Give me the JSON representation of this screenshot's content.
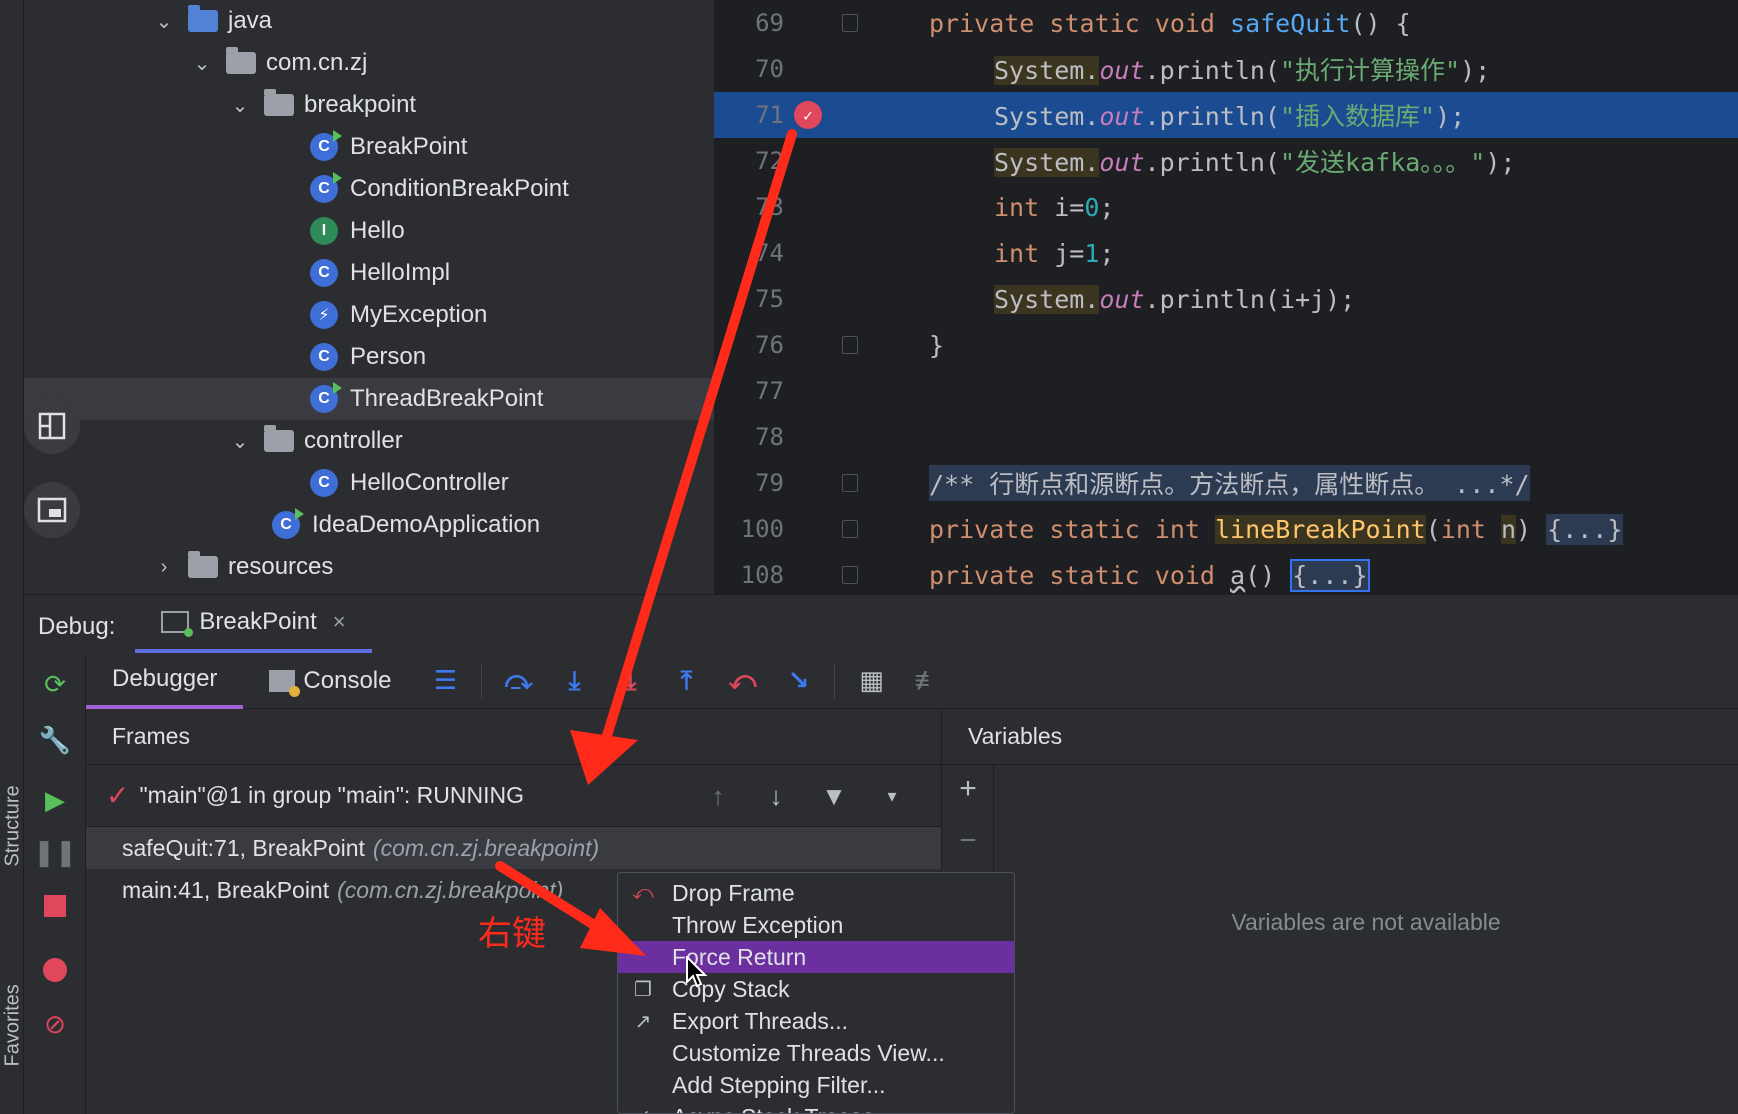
{
  "sidebar": {
    "structure_label": "Structure",
    "favorites_label": "Favorites"
  },
  "project_tree": {
    "items": [
      {
        "label": "java",
        "kind": "folder-blue",
        "chevron": "down",
        "indent": 0
      },
      {
        "label": "com.cn.zj",
        "kind": "package",
        "chevron": "down",
        "indent": 1
      },
      {
        "label": "breakpoint",
        "kind": "package",
        "chevron": "down",
        "indent": 2
      },
      {
        "label": "BreakPoint",
        "kind": "class-run",
        "indent": 3
      },
      {
        "label": "ConditionBreakPoint",
        "kind": "class-run",
        "indent": 3
      },
      {
        "label": "Hello",
        "kind": "interface",
        "indent": 3
      },
      {
        "label": "HelloImpl",
        "kind": "class",
        "indent": 3
      },
      {
        "label": "MyException",
        "kind": "exception",
        "indent": 3
      },
      {
        "label": "Person",
        "kind": "class",
        "indent": 3
      },
      {
        "label": "ThreadBreakPoint",
        "kind": "class-run",
        "indent": 3,
        "selected": true
      },
      {
        "label": "controller",
        "kind": "package",
        "chevron": "down",
        "indent": 2
      },
      {
        "label": "HelloController",
        "kind": "class",
        "indent": 3
      },
      {
        "label": "IdeaDemoApplication",
        "kind": "spring-class",
        "indent": 2
      },
      {
        "label": "resources",
        "kind": "resources-folder",
        "chevron": "right",
        "indent": 0
      }
    ]
  },
  "editor": {
    "lines": [
      {
        "num": "69",
        "text": "private static void safeQuit() {"
      },
      {
        "num": "70",
        "text": "System.out.println(\"执行计算操作\");"
      },
      {
        "num": "71",
        "text": "System.out.println(\"插入数据库\");",
        "current": true
      },
      {
        "num": "72",
        "text": "System.out.println(\"发送kafka。。。\");"
      },
      {
        "num": "73",
        "text": "int i=0;"
      },
      {
        "num": "74",
        "text": "int j=1;"
      },
      {
        "num": "75",
        "text": "System.out.println(i+j);"
      },
      {
        "num": "76",
        "text": "}"
      },
      {
        "num": "77",
        "text": ""
      },
      {
        "num": "78",
        "text": ""
      },
      {
        "num": "79",
        "text": "/** 行断点和源断点。方法断点，属性断点。 ...*/"
      },
      {
        "num": "100",
        "text": "private static int lineBreakPoint(int n) {...}"
      },
      {
        "num": "108",
        "text": "private static void a() {...}"
      }
    ]
  },
  "debug": {
    "label": "Debug:",
    "session_tab": "BreakPoint",
    "close_glyph": "×",
    "tabs": {
      "debugger": "Debugger",
      "console": "Console"
    },
    "frames_title": "Frames",
    "variables_title": "Variables",
    "thread": "\"main\"@1 in group \"main\": RUNNING",
    "frames": [
      {
        "method": "safeQuit:71, BreakPoint",
        "pkg": "(com.cn.zj.breakpoint)",
        "selected": true
      },
      {
        "method": "main:41, BreakPoint",
        "pkg": "(com.cn.zj.breakpoint)"
      }
    ],
    "no_variables": "Variables are not available"
  },
  "context_menu": {
    "items": [
      {
        "label": "Drop Frame",
        "icon": "drop-frame-icon"
      },
      {
        "label": "Throw Exception",
        "icon": ""
      },
      {
        "label": "Force Return",
        "icon": "",
        "active": true
      },
      {
        "label": "Copy Stack",
        "icon": "copy-icon"
      },
      {
        "label": "Export Threads...",
        "icon": "export-icon"
      },
      {
        "label": "Customize Threads View...",
        "icon": ""
      },
      {
        "label": "Add Stepping Filter...",
        "icon": ""
      },
      {
        "label": "Async Stack Traces",
        "icon": "check-icon"
      }
    ]
  },
  "annotation": {
    "label": "右键",
    "color": "#ff2a1a"
  },
  "colors": {
    "accent": "#5f6ddf",
    "menu_highlight": "#6b2fa0",
    "current_line": "#1b4c91",
    "breakpoint": "#e0475c"
  }
}
